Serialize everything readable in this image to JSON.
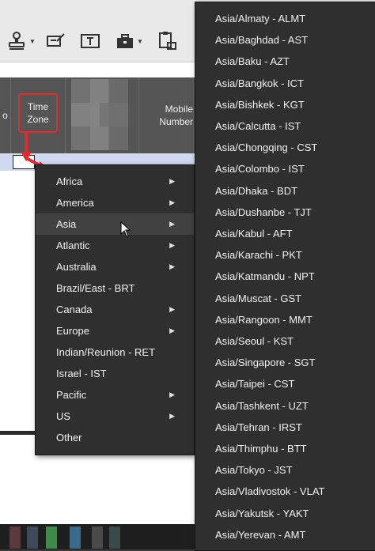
{
  "grid": {
    "col_left_fragment": "o",
    "time_zone_label_line1": "Time",
    "time_zone_label_line2": "Zone",
    "mobile_label_line1": "Mobile",
    "mobile_label_line2": "Number"
  },
  "toolbar": {
    "icons": [
      "stamp-icon",
      "edit-icon",
      "text-field-icon",
      "briefcase-icon",
      "clipboard-icon"
    ]
  },
  "menu_regions": {
    "items": [
      {
        "label": "Africa",
        "has_submenu": true
      },
      {
        "label": "America",
        "has_submenu": true
      },
      {
        "label": "Asia",
        "has_submenu": true,
        "highlighted": true
      },
      {
        "label": "Atlantic",
        "has_submenu": true
      },
      {
        "label": "Australia",
        "has_submenu": true
      },
      {
        "label": "Brazil/East - BRT",
        "has_submenu": false
      },
      {
        "label": "Canada",
        "has_submenu": true
      },
      {
        "label": "Europe",
        "has_submenu": true
      },
      {
        "label": "Indian/Reunion - RET",
        "has_submenu": false
      },
      {
        "label": "Israel - IST",
        "has_submenu": false
      },
      {
        "label": "Pacific",
        "has_submenu": true
      },
      {
        "label": "US",
        "has_submenu": true
      },
      {
        "label": "Other",
        "has_submenu": false
      }
    ]
  },
  "menu_asia": {
    "items": [
      "Asia/Almaty - ALMT",
      "Asia/Baghdad - AST",
      "Asia/Baku - AZT",
      "Asia/Bangkok - ICT",
      "Asia/Bishkek - KGT",
      "Asia/Calcutta - IST",
      "Asia/Chongqing - CST",
      "Asia/Colombo - IST",
      "Asia/Dhaka - BDT",
      "Asia/Dushanbe - TJT",
      "Asia/Kabul - AFT",
      "Asia/Karachi - PKT",
      "Asia/Katmandu - NPT",
      "Asia/Muscat - GST",
      "Asia/Rangoon - MMT",
      "Asia/Seoul - KST",
      "Asia/Singapore - SGT",
      "Asia/Taipei - CST",
      "Asia/Tashkent - UZT",
      "Asia/Tehran - IRST",
      "Asia/Thimphu - BTT",
      "Asia/Tokyo - JST",
      "Asia/Vladivostok - VLAT",
      "Asia/Yakutsk - YAKT",
      "Asia/Yerevan - AMT"
    ]
  },
  "colors": {
    "menu_bg": "#2f2f2f",
    "menu_highlight": "#414141",
    "annotation_red": "#e3282e",
    "selected_row": "#cfd9f0"
  }
}
